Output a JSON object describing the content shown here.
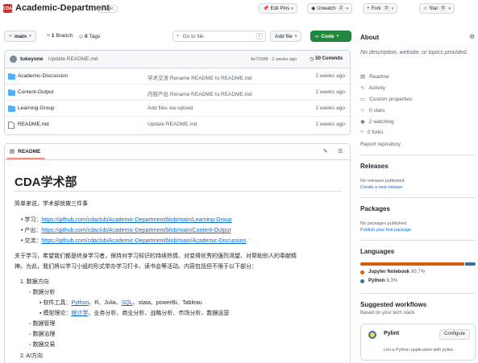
{
  "header": {
    "logo_text": "CDA",
    "repo_name": "Academic-Department",
    "visibility": "Public",
    "edit_pins": "Edit Pins",
    "unwatch": "Unwatch",
    "unwatch_count": "2",
    "fork": "Fork",
    "fork_count": "0",
    "star": "Star",
    "star_count": "0"
  },
  "toolbar": {
    "branch": "main",
    "branches_count": "1",
    "branches_label": "Branch",
    "tags_count": "0",
    "tags_label": "Tags",
    "search_placeholder": "Go to file",
    "search_kbd": "t",
    "add_file": "Add file",
    "code": "Code"
  },
  "commit": {
    "author": "tukeyone",
    "message": "Update README.md",
    "sha_time": "8e72088 · 2 weeks ago",
    "commits": "50 Commits"
  },
  "files": [
    {
      "type": "folder",
      "name": "Academic-Discussion",
      "message": "学术交流 Rename README to README.md",
      "date": "2 weeks ago"
    },
    {
      "type": "folder",
      "name": "Content-Output",
      "message": "内容产出 Rename README to README.md",
      "date": "2 weeks ago"
    },
    {
      "type": "folder",
      "name": "Learning-Group",
      "message": "Add files via upload",
      "date": "2 weeks ago"
    },
    {
      "type": "file",
      "name": "README.md",
      "message": "Update README.md",
      "date": "2 weeks ago"
    }
  ],
  "readme": {
    "tab": "README",
    "title": "CDA学术部",
    "intro": "简单来说，学术部就做三件事",
    "links": [
      {
        "label": "学习：",
        "url": "https://github.com/cdaclub/Academic-Department/blob/main/Learning-Group"
      },
      {
        "label": "产出：",
        "url": "https://github.com/cdaclub/Academic-Department/blob/main/Content-Output"
      },
      {
        "label": "交流：",
        "url": "https://github.com/cdaclub/Academic-Department/blob/main/Academic-Discussion"
      }
    ],
    "para_line1": "关于学习，希望我们都是终身学习者，保持对学习知识的持续热情、对变得优秀的强烈渴望、对帮助别人的奉献精",
    "para_line2": "神。为此，我们将以学习小组的形式举办学习打卡、读书会等活动。内容包括但不限于以下部分：",
    "ol1": "数据方向",
    "data_analysis": "数据分析",
    "tools_label": "软件工具：",
    "tool_python": "Python",
    "tools_mid": "、R、Julia、",
    "tool_sql": "SQL",
    "tools_rest": "、stata、powerBi、Tableau",
    "models_label": "模型理论：",
    "model_stat": "统计学",
    "models_rest": "、业务分析、商业分析、战略分析、市场分析、数据运营",
    "data_mgmt": "数据管理",
    "data_gov": "数据治理",
    "data_trade": "数据交易",
    "ol2": "AI方向"
  },
  "sidebar": {
    "about": "About",
    "description": "No description, website, or topics provided.",
    "readme": "Readme",
    "activity": "Activity",
    "custom_props": "Custom properties",
    "stars": "0 stars",
    "watching": "2 watching",
    "forks": "0 forks",
    "report": "Report repository",
    "releases": "Releases",
    "no_releases": "No releases published",
    "create_release": "Create a new release",
    "packages": "Packages",
    "no_packages": "No packages published",
    "publish_package": "Publish your first package",
    "languages": "Languages",
    "lang1_name": "Jupyter Notebook",
    "lang1_pct": "90.7%",
    "lang1_color": "#DA5B0B",
    "lang2_name": "Python",
    "lang2_pct": "9.3%",
    "lang2_color": "#3572A5",
    "suggested": "Suggested workflows",
    "suggested_sub": "Based on your tech stack",
    "wf_name": "Pylint",
    "wf_configure": "Configure",
    "wf_desc": "Lint a Python application with pylint."
  }
}
